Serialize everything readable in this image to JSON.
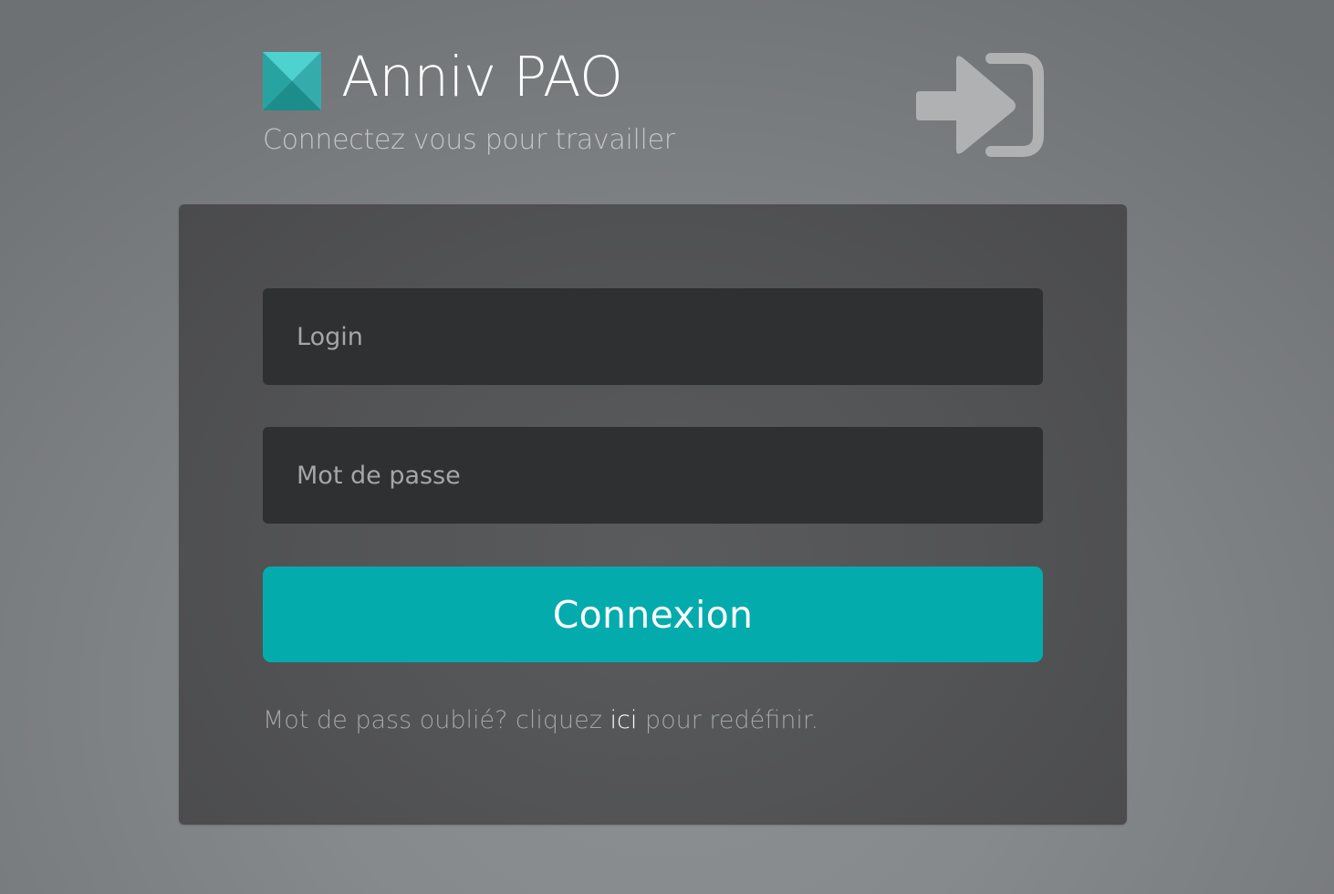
{
  "header": {
    "app_title": "Anniv PAO",
    "subtitle": "Connectez vous pour travailler",
    "logo_icon": "app-logo-icon",
    "login_icon": "sign-in-icon"
  },
  "form": {
    "login_placeholder": "Login",
    "login_value": "",
    "password_placeholder": "Mot de passe",
    "password_value": "",
    "submit_label": "Connexion"
  },
  "forgot_password": {
    "text_before": "Mot de pass oublié? cliquez ",
    "link_text": "ici",
    "text_after": " pour redéfinir."
  },
  "colors": {
    "accent": "#04abad",
    "logo_light": "#4dd2d0",
    "logo_mid": "#2fa7a6",
    "logo_dark": "#1c8d8b",
    "icon_gray": "#b0b1b3"
  }
}
